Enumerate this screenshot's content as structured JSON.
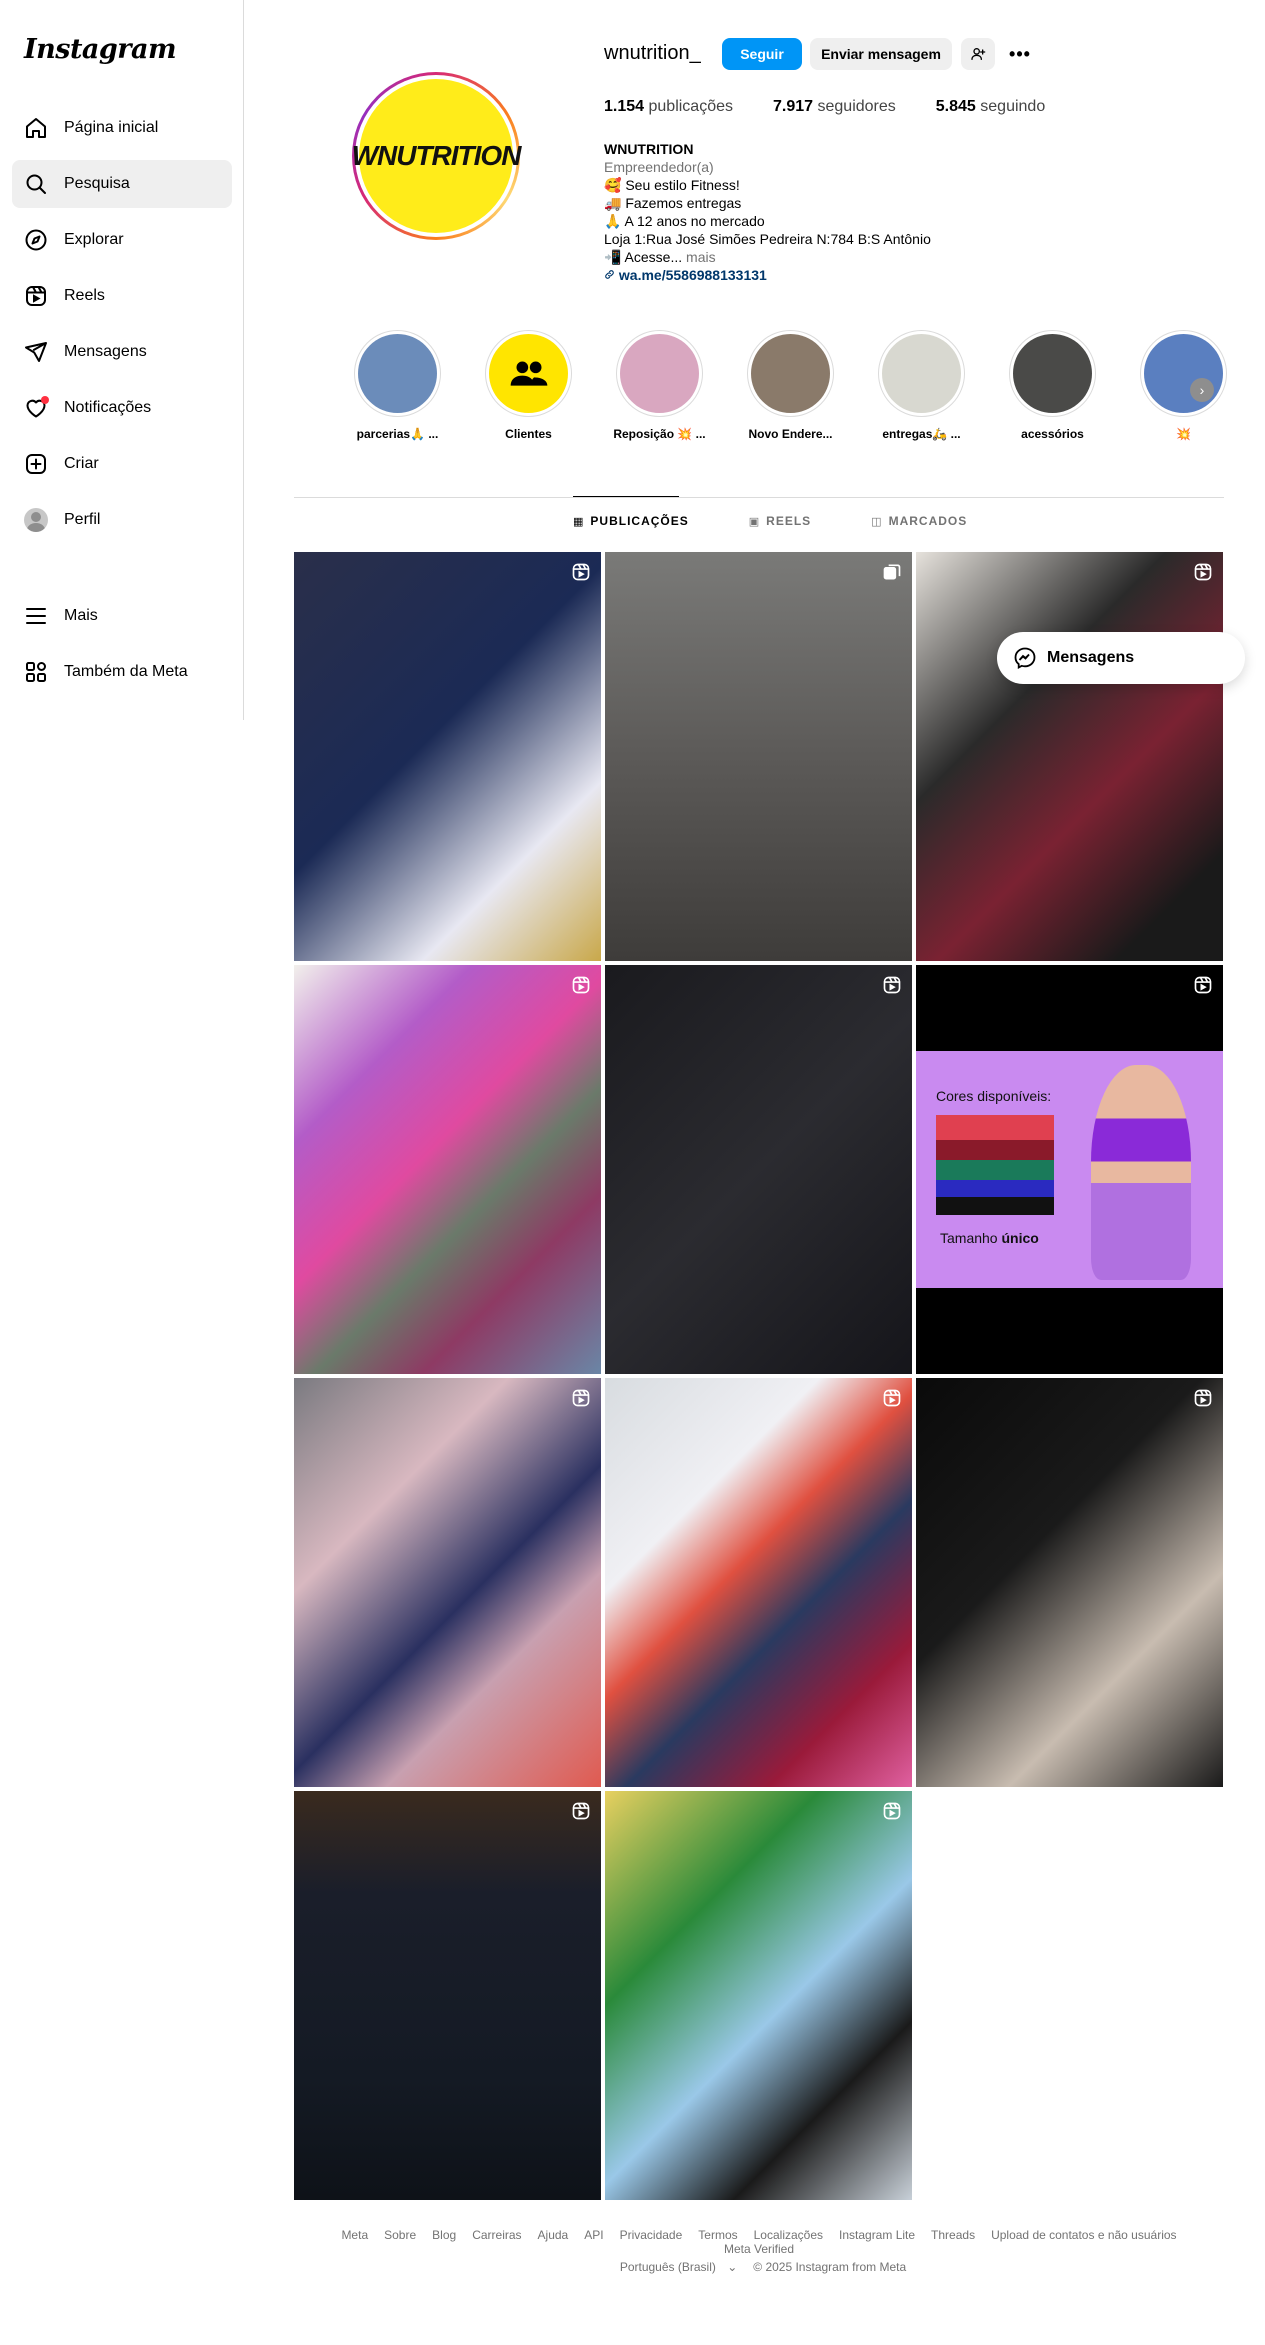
{
  "app": {
    "logo": "Instagram"
  },
  "sidebar": {
    "items": [
      {
        "label": "Página inicial",
        "icon": "home-icon"
      },
      {
        "label": "Pesquisa",
        "icon": "search-icon"
      },
      {
        "label": "Explorar",
        "icon": "compass-icon"
      },
      {
        "label": "Reels",
        "icon": "reels-icon"
      },
      {
        "label": "Mensagens",
        "icon": "send-icon"
      },
      {
        "label": "Notificações",
        "icon": "heart-icon"
      },
      {
        "label": "Criar",
        "icon": "plus-square-icon"
      },
      {
        "label": "Perfil",
        "icon": "avatar"
      }
    ],
    "bottom": [
      {
        "label": "Mais",
        "icon": "menu-icon"
      },
      {
        "label": "Também da Meta",
        "icon": "apps-icon"
      }
    ],
    "active_index": 1
  },
  "profile": {
    "username": "wnutrition_",
    "logo_text": "WNUTRITION",
    "follow_label": "Seguir",
    "message_label": "Enviar mensagem",
    "more_label": "•••",
    "stats": {
      "posts_count": "1.154",
      "posts_label": "publicações",
      "followers_count": "7.917",
      "followers_label": "seguidores",
      "following_count": "5.845",
      "following_label": "seguindo"
    },
    "bio": {
      "name": "WNUTRITION",
      "category": "Empreendedor(a)",
      "lines": [
        "🥰 Seu estilo Fitness!",
        "🚚 Fazemos entregas",
        "🙏 A 12 anos no mercado",
        "Loja 1:Rua José Simões Pedreira N:784 B:S Antônio"
      ],
      "last_line": "📲 Acesse...",
      "more": " mais",
      "link": "wa.me/5586988133131"
    }
  },
  "highlights": [
    {
      "label": "parcerias🙏 ...",
      "bg": "#6b8cba"
    },
    {
      "label": "Clientes",
      "bg": "#ffe500"
    },
    {
      "label": "Reposição 💥 ...",
      "bg": "#d9a7c0"
    },
    {
      "label": "Novo Endere...",
      "bg": "#8a7a6a"
    },
    {
      "label": "entregas🛵 ...",
      "bg": "#d8d8d0"
    },
    {
      "label": "acessórios",
      "bg": "#4a4a48"
    },
    {
      "label": "💥",
      "bg": "#5a7fc0"
    }
  ],
  "tabs": [
    {
      "label": "PUBLICAÇÕES",
      "icon": "grid-icon",
      "active": true
    },
    {
      "label": "REELS",
      "icon": "reels-icon",
      "active": false
    },
    {
      "label": "MARCADOS",
      "icon": "tagged-icon",
      "active": false
    }
  ],
  "posts": [
    {
      "type": "reel",
      "bg": "linear-gradient(135deg,#2a2f4a,#1b2a55 45%,#e8e8f2 75%,#c9a84a)"
    },
    {
      "type": "carousel",
      "bg": "linear-gradient(180deg,#7a7a78,#5c5a58 50%,#3e3c3a)"
    },
    {
      "type": "reel",
      "bg": "linear-gradient(135deg,#e6e2dc,#2a2a2a 35%,#7a2232 60%,#1a1a1a 85%)"
    },
    {
      "type": "reel",
      "bg": "linear-gradient(135deg,#f2f0ec,#b35cc8 25%,#e04aa0 45%,#6a7a6a 60%,#8e3a64 75%,#6a86a6)"
    },
    {
      "type": "reel",
      "bg": "linear-gradient(135deg,#1a1a1e,#2b2b30 50%,#15151a)"
    },
    {
      "type": "reel",
      "bg": "linear-gradient(180deg,#000 0%,#000 21%,#c98af0 21%,#c98af0 79%,#000 79%)",
      "text1": "Cores disponíveis:",
      "text2": "Tamanho",
      "text3": "único"
    },
    {
      "type": "reel",
      "bg": "linear-gradient(135deg,#7a7a80,#d8b8c0 30%,#2a3060 55%,#c8a0b0 70%,#e05a50)"
    },
    {
      "type": "reel",
      "bg": "linear-gradient(135deg,#d8dce0,#f0f0f4 30%,#e05040 45%,#2a3a60 60%,#9a1a3a 80%,#e060a0)"
    },
    {
      "type": "reel",
      "bg": "linear-gradient(135deg,#0a0a0a,#1a1a1a 40%,#c8bcb0 70%,#1a1a1a)"
    },
    {
      "type": "reel",
      "bg": "linear-gradient(180deg,#3a2a1e,#1a1e2a 25%,#141a24 70%,#0e1218)"
    },
    {
      "type": "reel",
      "bg": "linear-gradient(135deg,#e8d060,#2a8a3a 30%,#9ac8e8 55%,#1a1a1a 75%,#c8d0d8)"
    }
  ],
  "messenger": {
    "label": "Mensagens"
  },
  "footer": {
    "links": [
      "Meta",
      "Sobre",
      "Blog",
      "Carreiras",
      "Ajuda",
      "API",
      "Privacidade",
      "Termos",
      "Localizações",
      "Instagram Lite",
      "Threads",
      "Upload de contatos e não usuários",
      "Meta Verified"
    ],
    "language": "Português (Brasil)",
    "copyright": "© 2025 Instagram from Meta"
  }
}
